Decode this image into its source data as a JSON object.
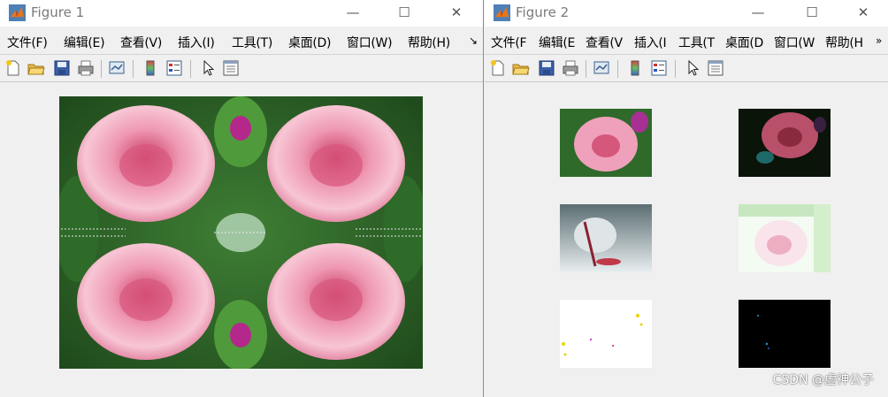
{
  "figures": [
    {
      "title": "Figure 1",
      "menu": [
        "文件(F)",
        "编辑(E)",
        "查看(V)",
        "插入(I)",
        "工具(T)",
        "桌面(D)",
        "窗口(W)",
        "帮助(H)"
      ],
      "menu_overflow": "↘"
    },
    {
      "title": "Figure 2",
      "menu": [
        "文件(F",
        "编辑(E",
        "查看(V",
        "插入(I",
        "工具(T",
        "桌面(D",
        "窗口(W",
        "帮助(H"
      ],
      "menu_overflow": "»"
    }
  ],
  "window_controls": {
    "minimize": "—",
    "maximize": "☐",
    "close": "✕"
  },
  "toolbar_icons": [
    "new-figure-icon",
    "open-folder-icon",
    "save-icon",
    "print-icon",
    "link-plot-icon",
    "colorbar-icon",
    "legend-icon",
    "pointer-icon",
    "property-editor-icon"
  ],
  "figure1_image": "peony mirrored four-way composite",
  "figure2_subplots": [
    "original peony",
    "dark red-enhanced peony",
    "dark-gray ink filtered",
    "bright inverted peony",
    "mostly white threshold",
    "mostly black threshold"
  ],
  "watermark": "CSDN @虚神公子"
}
